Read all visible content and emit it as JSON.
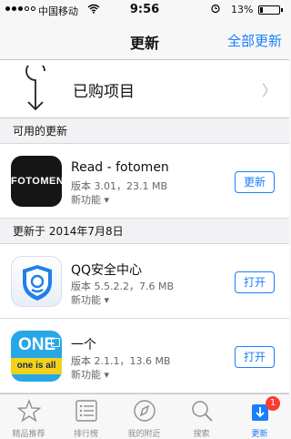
{
  "status_bar": {
    "carrier": "中国移动",
    "time": "9:56",
    "battery_percent": "13%",
    "battery_level": 0.13
  },
  "nav": {
    "title": "更新",
    "update_all": "全部更新"
  },
  "purchased": {
    "label": "已购项目"
  },
  "sections": {
    "available": "可用的更新",
    "updated_on": "更新于 2014年7月8日"
  },
  "apps": [
    {
      "name": "Read - fotomen",
      "meta": "版本 3.01，23.1 MB",
      "new_features": "新功能 ▾",
      "button": "更新",
      "icon_text": "FOTOMEN"
    },
    {
      "name": "QQ安全中心",
      "meta": "版本 5.5.2.2，7.6 MB",
      "new_features": "新功能 ▾",
      "button": "打开"
    },
    {
      "name": "一个",
      "meta": "版本 2.1.1，13.6 MB",
      "new_features": "新功能 ▾",
      "button": "打开",
      "icon_text_top": "ONE",
      "icon_text_bottom": "one is all"
    }
  ],
  "tabs": [
    {
      "label": "精品推荐",
      "icon": "star-icon"
    },
    {
      "label": "排行榜",
      "icon": "list-icon"
    },
    {
      "label": "我的附近",
      "icon": "location-icon"
    },
    {
      "label": "搜索",
      "icon": "search-icon"
    },
    {
      "label": "更新",
      "icon": "updates-icon",
      "badge": "1",
      "active": true
    }
  ],
  "colors": {
    "accent": "#1a7efb",
    "badge": "#ff3b30"
  }
}
